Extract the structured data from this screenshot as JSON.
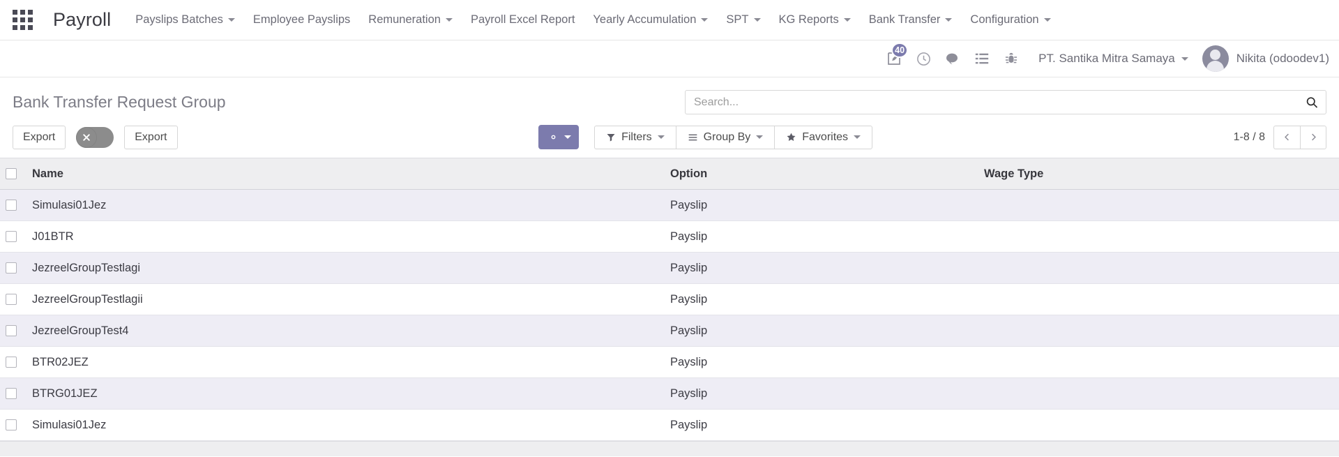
{
  "navbar": {
    "apps_icon": "apps-grid-icon",
    "app_title": "Payroll",
    "menu_items": [
      {
        "label": "Payslips Batches",
        "has_caret": true
      },
      {
        "label": "Employee Payslips",
        "has_caret": false
      },
      {
        "label": "Remuneration",
        "has_caret": true
      },
      {
        "label": "Payroll Excel Report",
        "has_caret": false
      },
      {
        "label": "Yearly Accumulation",
        "has_caret": true
      },
      {
        "label": "SPT",
        "has_caret": true
      },
      {
        "label": "KG Reports",
        "has_caret": true
      },
      {
        "label": "Bank Transfer",
        "has_caret": true
      },
      {
        "label": "Configuration",
        "has_caret": true
      }
    ]
  },
  "systray": {
    "activities_icon": "note-edit-icon",
    "activities_badge": "40",
    "clock_icon": "clock-icon",
    "messages_icon": "chat-bubble-icon",
    "list_icon": "list-icon",
    "debug_icon": "bug-icon",
    "company": "PT. Santika Mitra Samaya",
    "user": "Nikita (odoodev1)",
    "avatar_icon": "user-avatar"
  },
  "control_panel": {
    "breadcrumb": "Bank Transfer Request Group",
    "search": {
      "placeholder": "Search...",
      "value": "",
      "icon": "search-icon"
    },
    "export_left_label": "Export",
    "export_right_label": "Export",
    "toggle_icon": "close-x-icon",
    "gear_icon": "gear-icon",
    "filters_label": "Filters",
    "filters_icon": "filter-funnel-icon",
    "group_by_label": "Group By",
    "group_by_icon": "hamburger-lines-icon",
    "favorites_label": "Favorites",
    "favorites_icon": "star-icon",
    "pager_count": "1-8 / 8",
    "pager_prev_icon": "chevron-left-icon",
    "pager_next_icon": "chevron-right-icon"
  },
  "accent_colors": {
    "primary_purple": "#7c7bad",
    "row_stripe": "#eeedf5",
    "header_grey": "#eeeef0"
  },
  "table": {
    "columns": [
      "Name",
      "Option",
      "Wage Type"
    ],
    "rows": [
      {
        "name": "Simulasi01Jez",
        "option": "Payslip",
        "wage_type": ""
      },
      {
        "name": "J01BTR",
        "option": "Payslip",
        "wage_type": ""
      },
      {
        "name": "JezreelGroupTestlagi",
        "option": "Payslip",
        "wage_type": ""
      },
      {
        "name": "JezreelGroupTestlagii",
        "option": "Payslip",
        "wage_type": ""
      },
      {
        "name": "JezreelGroupTest4",
        "option": "Payslip",
        "wage_type": ""
      },
      {
        "name": "BTR02JEZ",
        "option": "Payslip",
        "wage_type": ""
      },
      {
        "name": "BTRG01JEZ",
        "option": "Payslip",
        "wage_type": ""
      },
      {
        "name": "Simulasi01Jez",
        "option": "Payslip",
        "wage_type": ""
      }
    ]
  }
}
